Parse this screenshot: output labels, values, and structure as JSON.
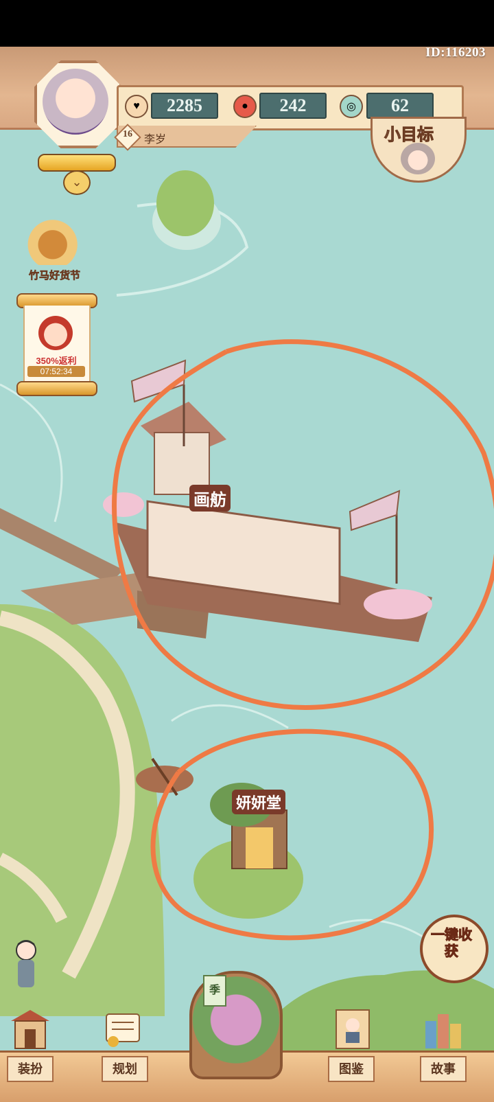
{
  "header": {
    "player_id": "ID:116203",
    "level": "16",
    "player_name": "李岁"
  },
  "resources": [
    {
      "icon": "heart-coin-icon",
      "value": "2285"
    },
    {
      "icon": "red-gem-icon",
      "value": "242"
    },
    {
      "icon": "stamina-icon",
      "value": "62"
    }
  ],
  "goal_button": {
    "label": "小目标"
  },
  "side_events": {
    "festival_label": "竹马好货节",
    "promo_percent": "350%返利",
    "promo_timer": "07:52:34"
  },
  "map": {
    "boat_sign": "画舫",
    "building_sign": "妍妍堂"
  },
  "harvest_button": {
    "label": "一键收获"
  },
  "season_tag": "季",
  "bottom_nav": {
    "items": [
      {
        "label": "装扮",
        "icon": "gate-icon"
      },
      {
        "label": "规划",
        "icon": "scroll-plan-icon"
      },
      {
        "label": "图鉴",
        "icon": "portrait-album-icon"
      },
      {
        "label": "故事",
        "icon": "story-books-icon"
      }
    ]
  },
  "colors": {
    "water": "#a9d9d2",
    "header": "#e3b690",
    "circle_annotation": "#ef7a45"
  }
}
